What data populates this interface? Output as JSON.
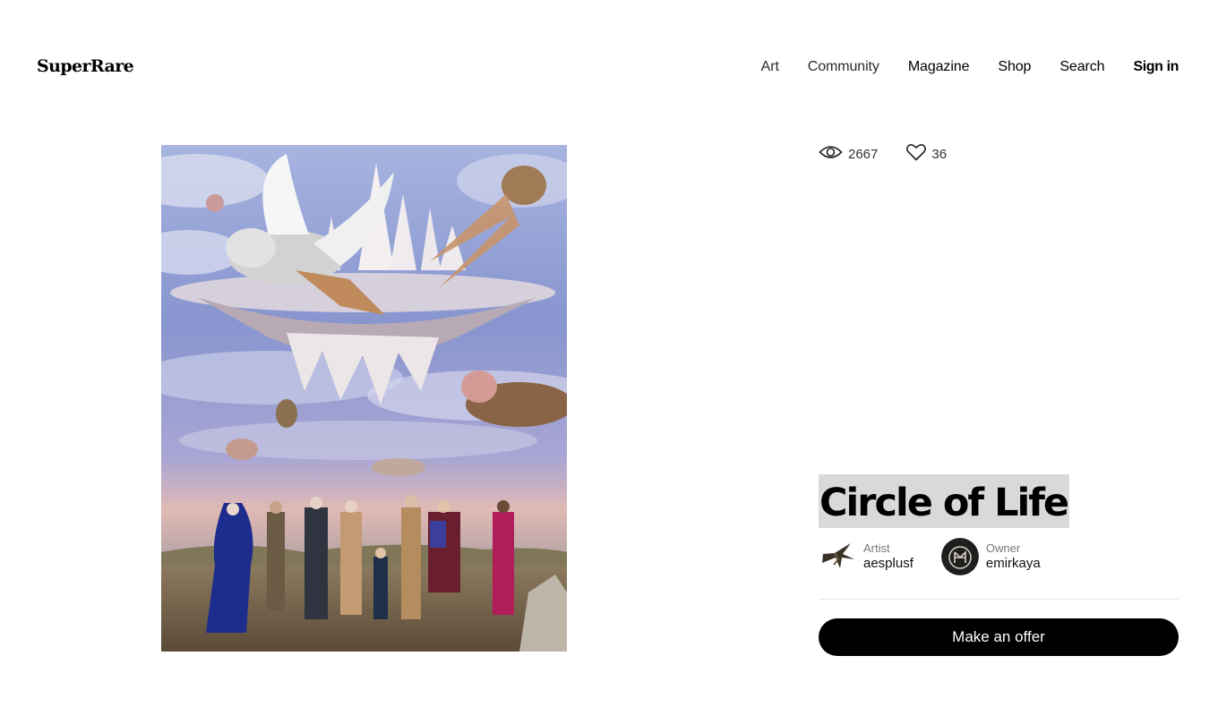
{
  "header": {
    "logo": "SuperRare",
    "nav": {
      "art": "Art",
      "community": "Community",
      "magazine": "Magazine",
      "shop": "Shop",
      "search": "Search",
      "sign_in": "Sign in"
    }
  },
  "artwork": {
    "stats": {
      "views": "2667",
      "likes": "36",
      "view_icon": "eye-icon",
      "like_icon": "heart-icon"
    },
    "title": "Circle of Life",
    "artist": {
      "role": "Artist",
      "handle": "aesplusf"
    },
    "owner": {
      "role": "Owner",
      "handle": "emirkaya"
    },
    "offer_button": "Make an offer"
  },
  "colors": {
    "button_bg": "#000000",
    "button_text": "#ffffff",
    "title_highlight": "#d9d9d9"
  }
}
